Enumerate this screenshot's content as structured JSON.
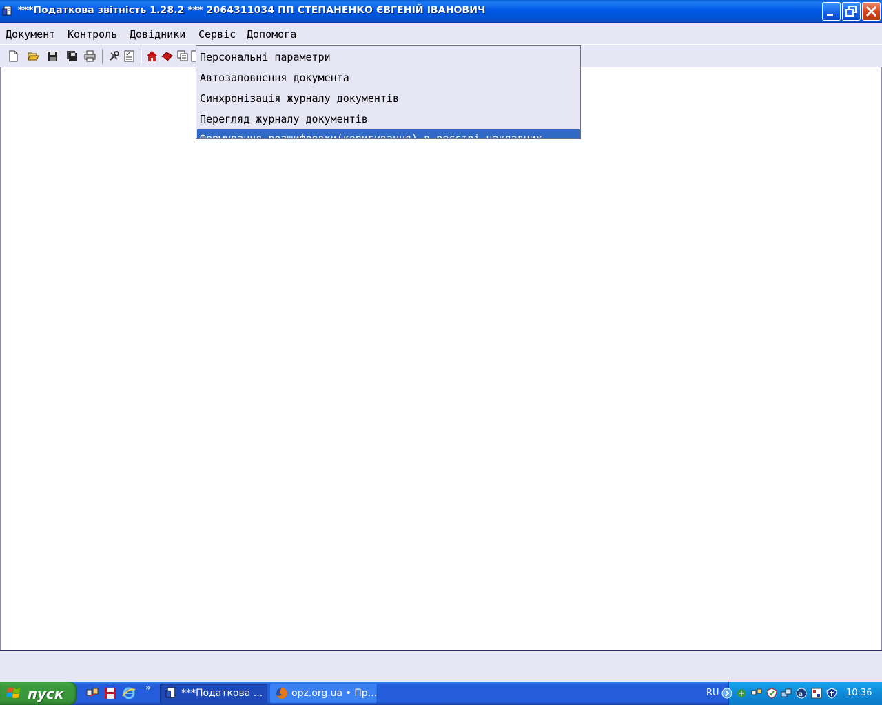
{
  "window": {
    "title": "***Податкова звітність 1.28.2 *** 2064311034 ПП СТЕПАНЕНКО ЄВГЕНІЙ ІВАНОВИЧ"
  },
  "menubar": {
    "items": [
      {
        "label": "Документ"
      },
      {
        "label": "Контроль"
      },
      {
        "label": "Довідники"
      },
      {
        "label": "Сервіс"
      },
      {
        "label": "Допомога"
      }
    ]
  },
  "service_menu": {
    "items": [
      {
        "label": "Персональні параметри"
      },
      {
        "label": "Автозаповнення документа"
      },
      {
        "label": "Синхронізація журналу документів"
      },
      {
        "label": "Перегляд журналу документів"
      },
      {
        "label": "Формування розшифровки(коригування) в реєстрі накладних"
      }
    ],
    "highlighted_index": 4
  },
  "toolbar": {
    "icons": [
      "new-document-icon",
      "open-folder-icon",
      "save-icon",
      "save-all-icon",
      "print-icon",
      "tools-icon",
      "checklist-icon",
      "home-icon",
      "book-icon",
      "copy-icon"
    ]
  },
  "taskbar": {
    "start_label": "пуск",
    "tasks": [
      {
        "label": "***Податкова ..."
      },
      {
        "label": "opz.org.ua • Пр..."
      }
    ],
    "language": "RU",
    "clock": "10:36"
  },
  "colors": {
    "titlebar": "#0058e6",
    "menu_bg": "#e6e6f5",
    "highlight": "#316ac5",
    "taskbar": "#245edb",
    "start": "#3c9a3c"
  }
}
